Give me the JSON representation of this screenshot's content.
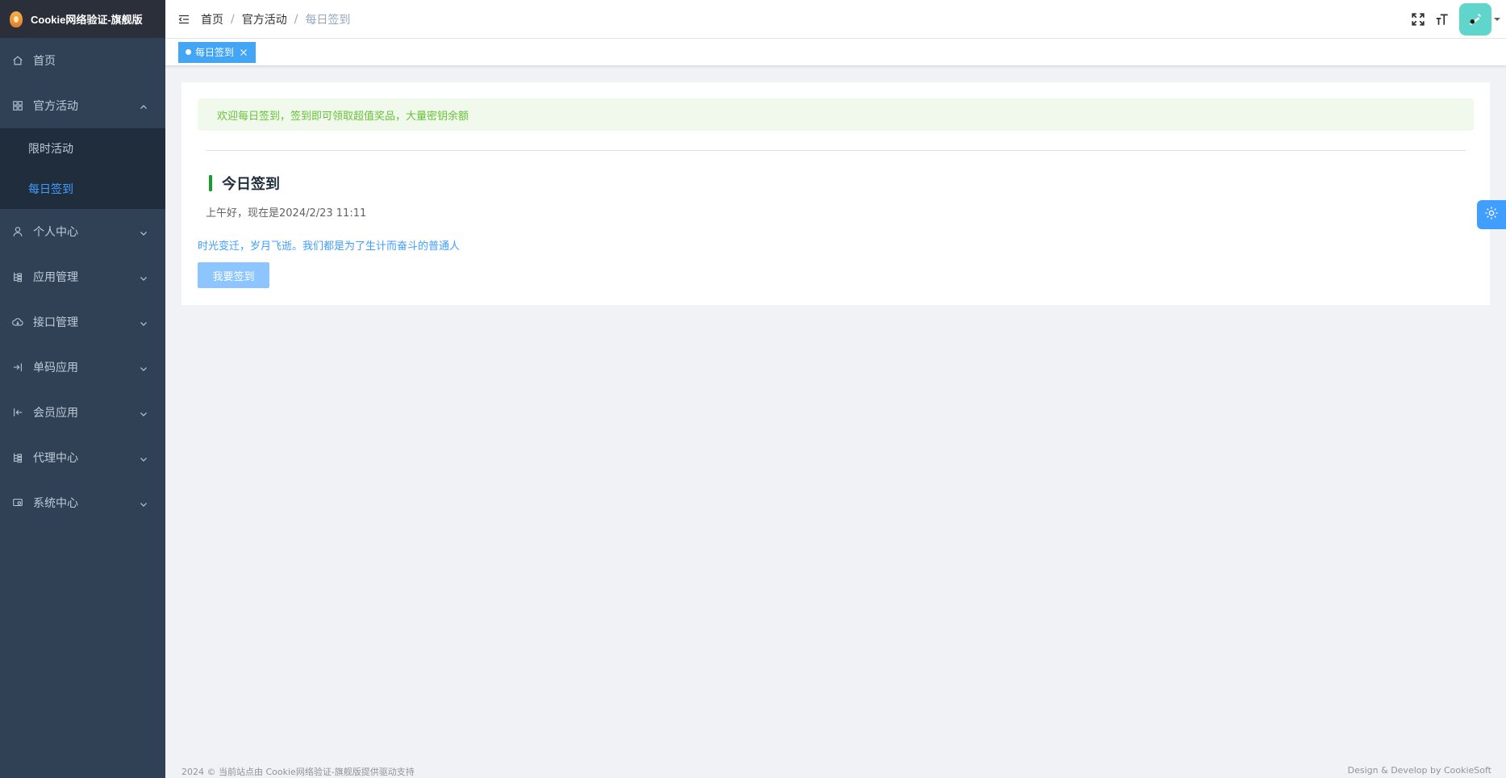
{
  "app": {
    "title": "Cookie网络验证-旗舰版"
  },
  "sidebar": {
    "items": [
      {
        "label": "首页",
        "icon": "home-icon"
      },
      {
        "label": "官方活动",
        "icon": "grid-icon",
        "expanded": true,
        "children": [
          {
            "label": "限时活动",
            "active": false
          },
          {
            "label": "每日签到",
            "active": true
          }
        ]
      },
      {
        "label": "个人中心",
        "icon": "user-icon"
      },
      {
        "label": "应用管理",
        "icon": "tree-icon"
      },
      {
        "label": "接口管理",
        "icon": "cloud-icon"
      },
      {
        "label": "单码应用",
        "icon": "login-icon"
      },
      {
        "label": "会员应用",
        "icon": "logout-icon"
      },
      {
        "label": "代理中心",
        "icon": "tree-icon"
      },
      {
        "label": "系统中心",
        "icon": "monitor-icon"
      }
    ]
  },
  "header": {
    "breadcrumb": [
      "首页",
      "官方活动",
      "每日签到"
    ],
    "separator": "/"
  },
  "tags": [
    {
      "label": "每日签到",
      "active": true
    }
  ],
  "main": {
    "alert": "欢迎每日签到，签到即可领取超值奖品，大量密钥余额",
    "section_title": "今日签到",
    "greeting": "上午好，现在是2024/2/23 11:11",
    "motto": "时光变迁，岁月飞逝。我们都是为了生计而奋斗的普通人",
    "sign_button": "我要签到"
  },
  "footer": {
    "left": "2024 © 当前站点由 Cookie网络验证-旗舰版提供驱动支持",
    "right": "Design & Develop by CookieSoft"
  },
  "colors": {
    "sidebar_bg": "#304156",
    "sidebar_text": "#bfcbd9",
    "accent": "#409eff",
    "alert_bg": "#f0f9eb",
    "alert_text": "#67c23a",
    "section_bar": "#1a9e2a"
  }
}
